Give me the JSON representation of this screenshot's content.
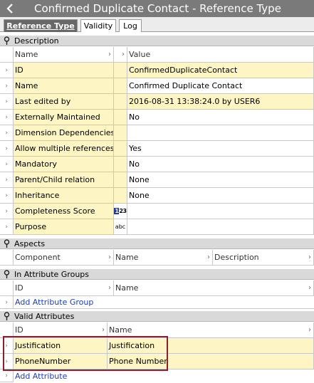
{
  "window": {
    "title": "Confirmed Duplicate Contact - Reference Type"
  },
  "tabs": [
    {
      "label": "Reference Type"
    },
    {
      "label": "Validity"
    },
    {
      "label": "Log"
    }
  ],
  "description": {
    "section_label": "Description",
    "col_name": "Name",
    "col_value": "Value",
    "rows": [
      {
        "name": "ID",
        "value": "ConfirmedDuplicateContact"
      },
      {
        "name": "Name",
        "value": "Confirmed Duplicate Contact"
      },
      {
        "name": "Last edited by",
        "value": "2016-08-31 13:38:24.0 by USER6"
      },
      {
        "name": "Externally Maintained",
        "value": "No"
      },
      {
        "name": "Dimension Dependencies",
        "value": ""
      },
      {
        "name": "Allow multiple references",
        "value": "Yes"
      },
      {
        "name": "Mandatory",
        "value": "No"
      },
      {
        "name": "Parent/Child relation",
        "value": "None"
      },
      {
        "name": "Inheritance",
        "value": "None"
      },
      {
        "name": "Completeness Score",
        "value": "",
        "icon": "123-icon"
      },
      {
        "name": "Purpose",
        "value": "",
        "icon": "abc-icon"
      }
    ]
  },
  "aspects": {
    "section_label": "Aspects",
    "col_component": "Component",
    "col_name": "Name",
    "col_description": "Description"
  },
  "attribute_groups": {
    "section_label": "In Attribute Groups",
    "col_id": "ID",
    "col_name": "Name",
    "add_label": "Add Attribute Group"
  },
  "valid_attributes": {
    "section_label": "Valid Attributes",
    "col_id": "ID",
    "col_name": "Name",
    "rows": [
      {
        "id": "Justification",
        "name": "Justification"
      },
      {
        "id": "PhoneNumber",
        "name": "Phone Number"
      }
    ],
    "add_label": "Add Attribute"
  },
  "colors": {
    "row_highlight": "#fdf5c3",
    "title_bar": "#7a7a7a",
    "selection_border": "#8e1e2c",
    "link": "#1b3fb5"
  }
}
